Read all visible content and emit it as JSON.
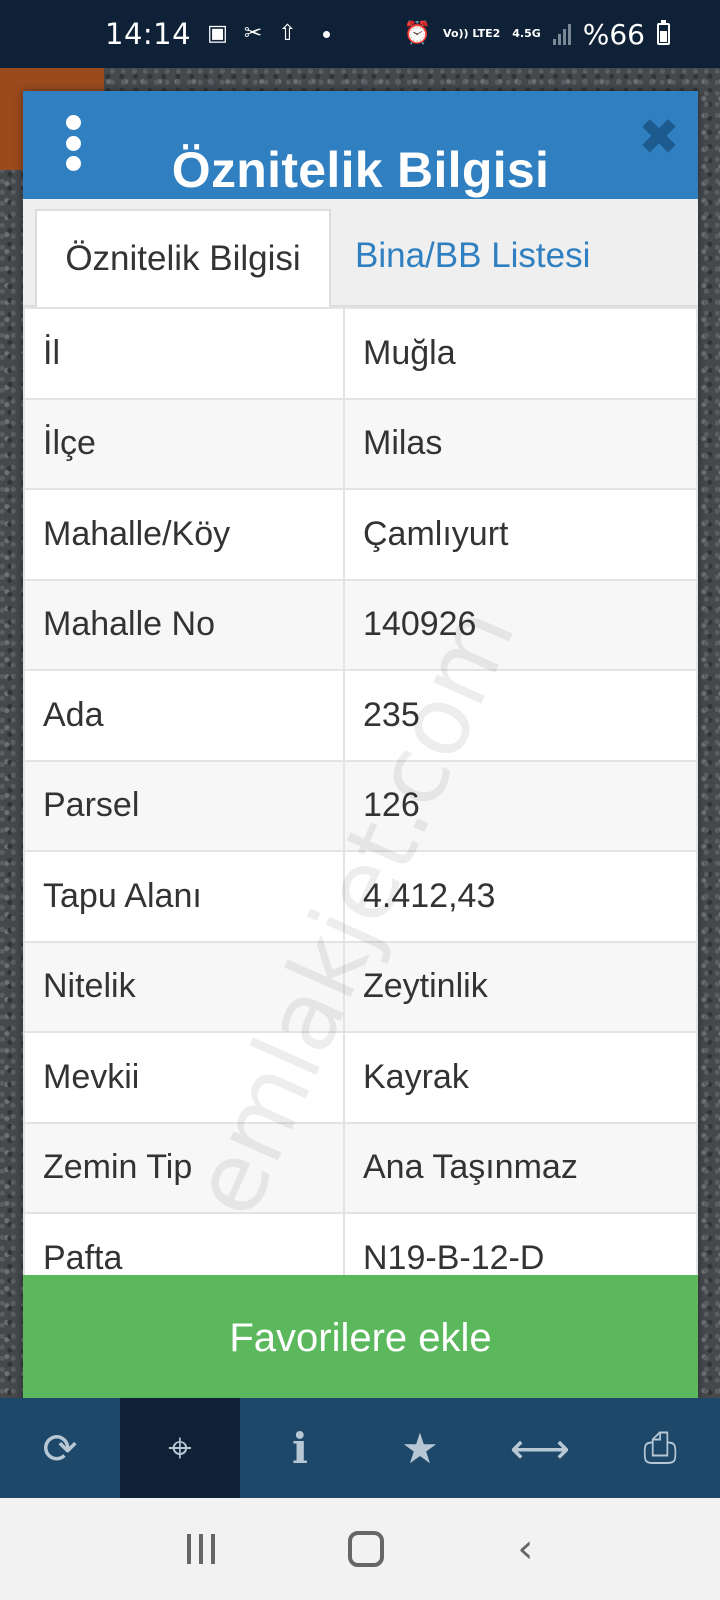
{
  "status_bar": {
    "time": "14:14",
    "icons": [
      "gallery-icon",
      "capcut-icon",
      "upload-cloud-icon",
      "dot-icon",
      "alarm-icon",
      "volte-icon",
      "signal-icon"
    ],
    "volte_label": "Vo)) LTE2",
    "network_type": "4.5G",
    "battery": "%66"
  },
  "dialog": {
    "title": "Öznitelik Bilgisi",
    "menu_icon": "kebab-menu-icon",
    "close_icon": "close-icon",
    "tabs": [
      {
        "label": "Öznitelik Bilgisi",
        "active": true
      },
      {
        "label": "Bina/BB Listesi",
        "active": false
      }
    ],
    "attributes": [
      {
        "key": "İl",
        "value": "Muğla"
      },
      {
        "key": "İlçe",
        "value": "Milas"
      },
      {
        "key": "Mahalle/Köy",
        "value": "Çamlıyurt"
      },
      {
        "key": "Mahalle No",
        "value": "140926"
      },
      {
        "key": "Ada",
        "value": "235"
      },
      {
        "key": "Parsel",
        "value": "126"
      },
      {
        "key": "Tapu Alanı",
        "value": "4.412,43"
      },
      {
        "key": "Nitelik",
        "value": "Zeytinlik"
      },
      {
        "key": "Mevkii",
        "value": "Kayrak"
      },
      {
        "key": "Zemin Tip",
        "value": "Ana Taşınmaz"
      },
      {
        "key": "Pafta",
        "value": "N19-B-12-D"
      }
    ],
    "watermark": "emlakjet.com",
    "favorite_button": "Favorilere ekle"
  },
  "toolbar": {
    "items": [
      "refresh-icon",
      "locate-icon",
      "info-icon",
      "star-icon",
      "measure-icon",
      "print-icon"
    ],
    "active": "locate-icon"
  },
  "nav_bar": {
    "items": [
      "recents-icon",
      "home-icon",
      "back-icon"
    ]
  },
  "colors": {
    "header": "#2f7fc1",
    "button": "#5cb85c",
    "toolbar": "#1d4869",
    "status_bar": "#0e2136"
  }
}
